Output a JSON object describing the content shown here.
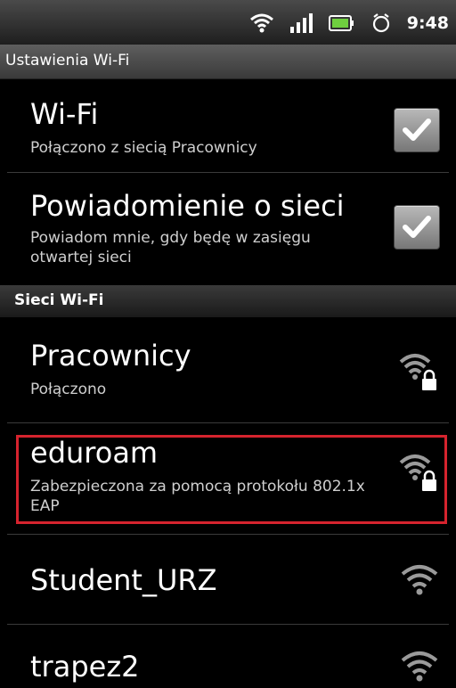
{
  "status_bar": {
    "time": "9:48",
    "icons": [
      "wifi-icon",
      "signal-icon",
      "battery-icon",
      "alarm-icon"
    ]
  },
  "header": {
    "title": "Ustawienia Wi-Fi"
  },
  "settings": {
    "wifi": {
      "title": "Wi-Fi",
      "summary": "Połączono z siecią Pracownicy",
      "checked": true
    },
    "notification": {
      "title": "Powiadomienie o sieci",
      "summary": "Powiadom mnie, gdy będę w zasięgu otwartej sieci",
      "checked": true
    }
  },
  "section": {
    "title": "Sieci Wi-Fi"
  },
  "networks": [
    {
      "name": "Pracownicy",
      "status": "Połączono",
      "secured": true,
      "icon": "wifi-lock-icon"
    },
    {
      "name": "eduroam",
      "status": "Zabezpieczona za pomocą protokołu 802.1x EAP",
      "secured": true,
      "icon": "wifi-lock-icon"
    },
    {
      "name": "Student_URZ",
      "status": "",
      "secured": false,
      "icon": "wifi-icon"
    },
    {
      "name": "trapez2",
      "status": "",
      "secured": false,
      "icon": "wifi-icon"
    }
  ],
  "colors": {
    "highlight": "#d6232e",
    "background": "#000000"
  }
}
